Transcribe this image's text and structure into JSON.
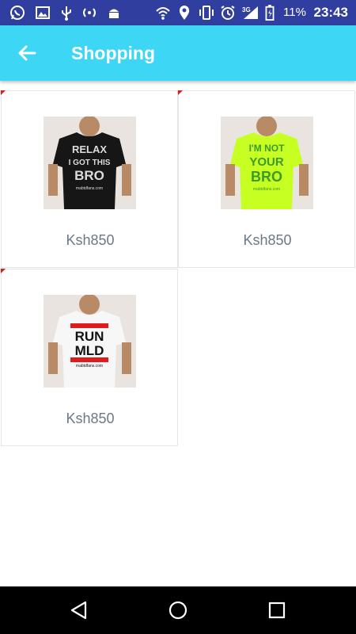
{
  "status_bar": {
    "battery_percent": "11%",
    "network": "3G",
    "time": "23:43",
    "icons": [
      "whatsapp-icon",
      "gallery-icon",
      "usb-icon",
      "hotspot-icon",
      "android-debug-icon",
      "wifi-icon",
      "location-icon",
      "vibrate-icon",
      "alarm-icon",
      "signal-icon",
      "battery-icon"
    ]
  },
  "toolbar": {
    "title": "Shopping",
    "back_icon": "back-arrow-icon",
    "color": "#3ED6F5"
  },
  "products": [
    {
      "price": "Ksh850",
      "shirt_color": "#161616",
      "lines": [
        "RELAX",
        "I GOT THIS",
        "BRO"
      ],
      "text_color": "#dcdcdc",
      "caption": "mabtdfans.com"
    },
    {
      "price": "Ksh850",
      "shirt_color": "#c8ff23",
      "lines": [
        "I'M NOT",
        "YOUR",
        "BRO"
      ],
      "text_color": "#3a9a2a",
      "caption": "mabtdfans.com"
    },
    {
      "price": "Ksh850",
      "shirt_color": "#f7f7f7",
      "lines": [
        "RUN",
        "MLD"
      ],
      "text_color": "#111111",
      "caption": "mabtdfans.com"
    }
  ],
  "nav_bar": {
    "icons": [
      "back-triangle-icon",
      "home-circle-icon",
      "recents-square-icon"
    ]
  }
}
